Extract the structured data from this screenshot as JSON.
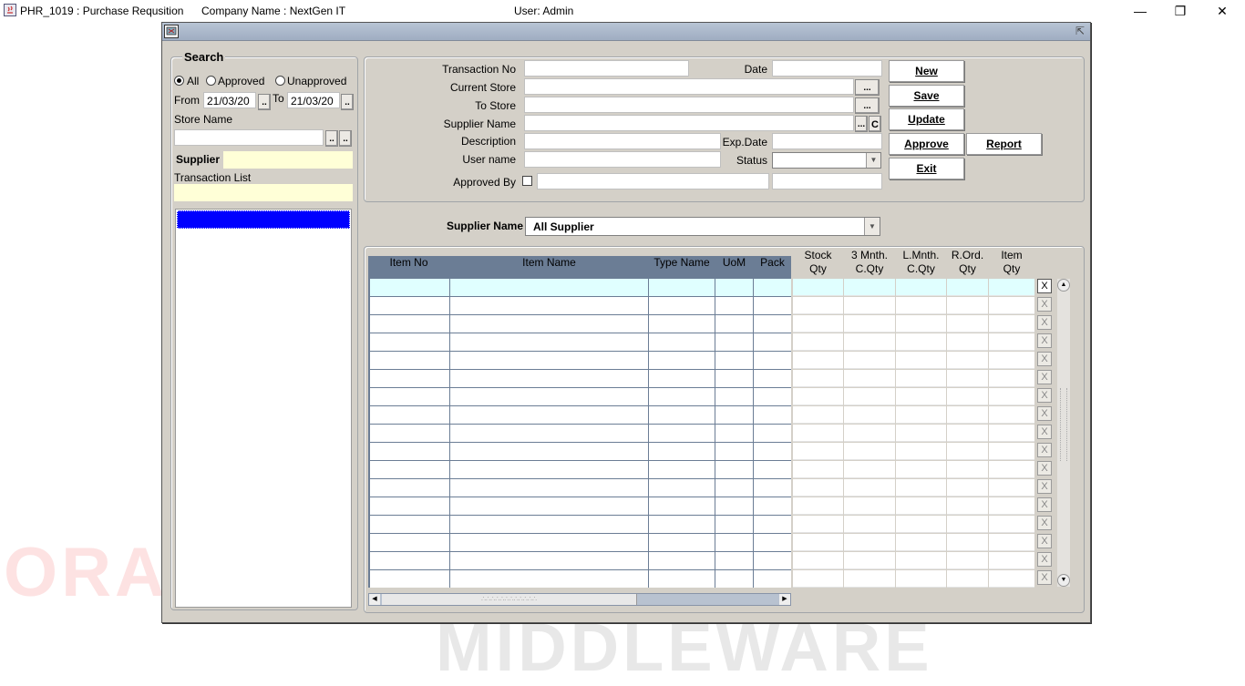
{
  "titlebar": {
    "app_title": "PHR_1019 : Purchase Requsition",
    "company": "Company Name : NextGen IT",
    "user": "User: Admin"
  },
  "window_controls": {
    "minimize": "—",
    "restore": "❐",
    "close": "✕"
  },
  "watermark": {
    "left": "ORA",
    "bottom": "MIDDLEWARE"
  },
  "search": {
    "title": "Search",
    "radio_all": "All",
    "radio_approved": "Approved",
    "radio_unapproved": "Unapproved",
    "selected": "All",
    "from_label": "From",
    "from_value": "21/03/20",
    "to_label": "To",
    "to_value": "21/03/20",
    "dots": "..",
    "store_name_label": "Store Name",
    "store_name_value": "",
    "supplier_label": "Supplier",
    "supplier_value": "",
    "transaction_list_label": "Transaction List",
    "transaction_list_value": ""
  },
  "form": {
    "transaction_no_label": "Transaction No",
    "transaction_no": "",
    "date_label": "Date",
    "date": "",
    "current_store_label": "Current Store",
    "current_store": "",
    "to_store_label": "To Store",
    "to_store": "",
    "supplier_name_label": "Supplier Name",
    "supplier_name": "",
    "description_label": "Description",
    "description": "",
    "exp_date_label": "Exp.Date",
    "exp_date": "",
    "user_name_label": "User name",
    "user_name": "",
    "status_label": "Status",
    "status": "",
    "approved_by_label": "Approved By",
    "approved_by": "",
    "dots": "...",
    "clear": "C"
  },
  "buttons": {
    "new": "New",
    "save": "Save",
    "update": "Update",
    "approve": "Approve",
    "report": "Report",
    "exit": "Exit"
  },
  "supplier_filter": {
    "label": "Supplier Name",
    "value": "All Supplier"
  },
  "grid": {
    "columns_dark": [
      "Item No",
      "Item Name",
      "Type Name",
      "UoM",
      "Pack"
    ],
    "columns_light": [
      {
        "line1": "Stock",
        "line2": "Qty"
      },
      {
        "line1": "3 Mnth.",
        "line2": "C.Qty"
      },
      {
        "line1": "L.Mnth.",
        "line2": "C.Qty"
      },
      {
        "line1": "R.Ord.",
        "line2": "Qty"
      },
      {
        "line1": "Item",
        "line2": "Qty"
      }
    ],
    "row_count": 17,
    "delete_label": "X"
  },
  "colors": {
    "grid_header": "#6b7d95",
    "selected_row": "#e0ffff",
    "list_selection": "#0000ff",
    "yellow_field": "#ffffd7",
    "window_bg": "#d4d0c8"
  }
}
